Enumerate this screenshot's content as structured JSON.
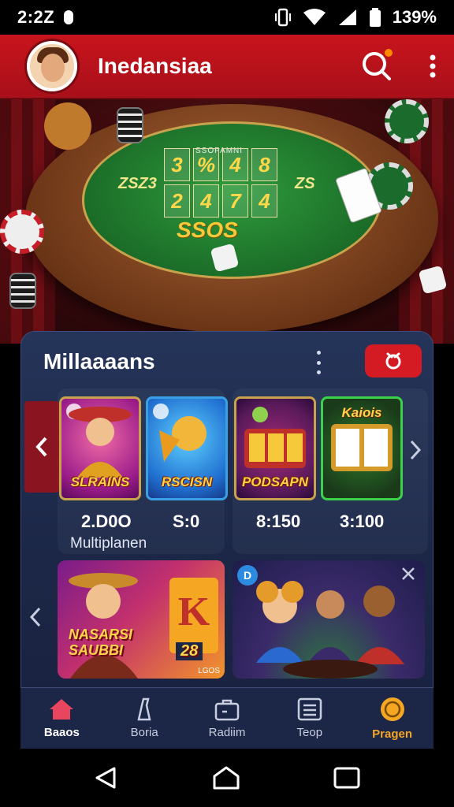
{
  "status_bar": {
    "time": "2:2Z",
    "battery": "139%"
  },
  "app_bar": {
    "title": "Inedansiaa",
    "search_icon": "search-icon",
    "more_icon": "more-vert-icon"
  },
  "hero": {
    "table_label": "SSOPAMNI",
    "grid": [
      "3",
      "%",
      "4",
      "8",
      "2",
      "4",
      "7",
      "4"
    ],
    "felt_number": "SSOS",
    "left_side": "ZSZ3",
    "right_side": "ZS"
  },
  "panel": {
    "title": "Millaaaans",
    "featured_group": {
      "tiles": [
        {
          "label": "SLRAINS"
        },
        {
          "label": "RSCISN"
        }
      ],
      "values": [
        "2.D0O",
        "S:0"
      ],
      "caption": "Multiplanen"
    },
    "second_group": {
      "tiles": [
        {
          "top": "",
          "label": "PODSAPN"
        },
        {
          "top": "Kaiois",
          "label": ""
        }
      ],
      "values": [
        "8:150",
        "3:100"
      ]
    },
    "banners": [
      {
        "title": "NASARSI SAUBBI",
        "number": "28",
        "tag": "LGOS"
      },
      {
        "info": "D"
      }
    ]
  },
  "bottom_nav": {
    "items": [
      {
        "label": "Baaos",
        "icon": "home-icon"
      },
      {
        "label": "Boria",
        "icon": "bottle-icon"
      },
      {
        "label": "Radiim",
        "icon": "briefcase-icon"
      },
      {
        "label": "Teop",
        "icon": "list-icon"
      },
      {
        "label": "Pragen",
        "icon": "coin-icon"
      }
    ]
  },
  "colors": {
    "brand_red": "#c8141c",
    "panel_bg": "#1c2747",
    "accent_gold": "#f5a623"
  }
}
